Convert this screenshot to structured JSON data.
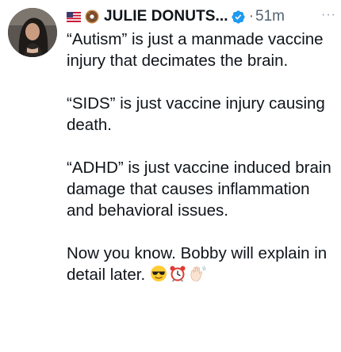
{
  "tweet": {
    "display_name": "JULIE DONUTS...",
    "separator": "·",
    "timestamp": "51m",
    "more_label": "···",
    "paragraphs": [
      "“Autism” is just a manmade vaccine injury that decimates the brain.",
      "“SIDS” is just vaccine injury causing death.",
      "“ADHD” is just vaccine induced brain damage that causes inflammation and behavioral issues.",
      "Now you know. Bobby will explain in detail later."
    ],
    "header_icons": [
      "us-flag-icon",
      "donut-icon",
      "verified-badge-icon"
    ],
    "trailing_emoji": [
      "sunglasses-face-emoji",
      "alarm-clock-emoji",
      "waving-hand-emoji"
    ]
  },
  "colors": {
    "text": "#0f1419",
    "muted": "#536471",
    "verified": "#1d9bf0"
  }
}
